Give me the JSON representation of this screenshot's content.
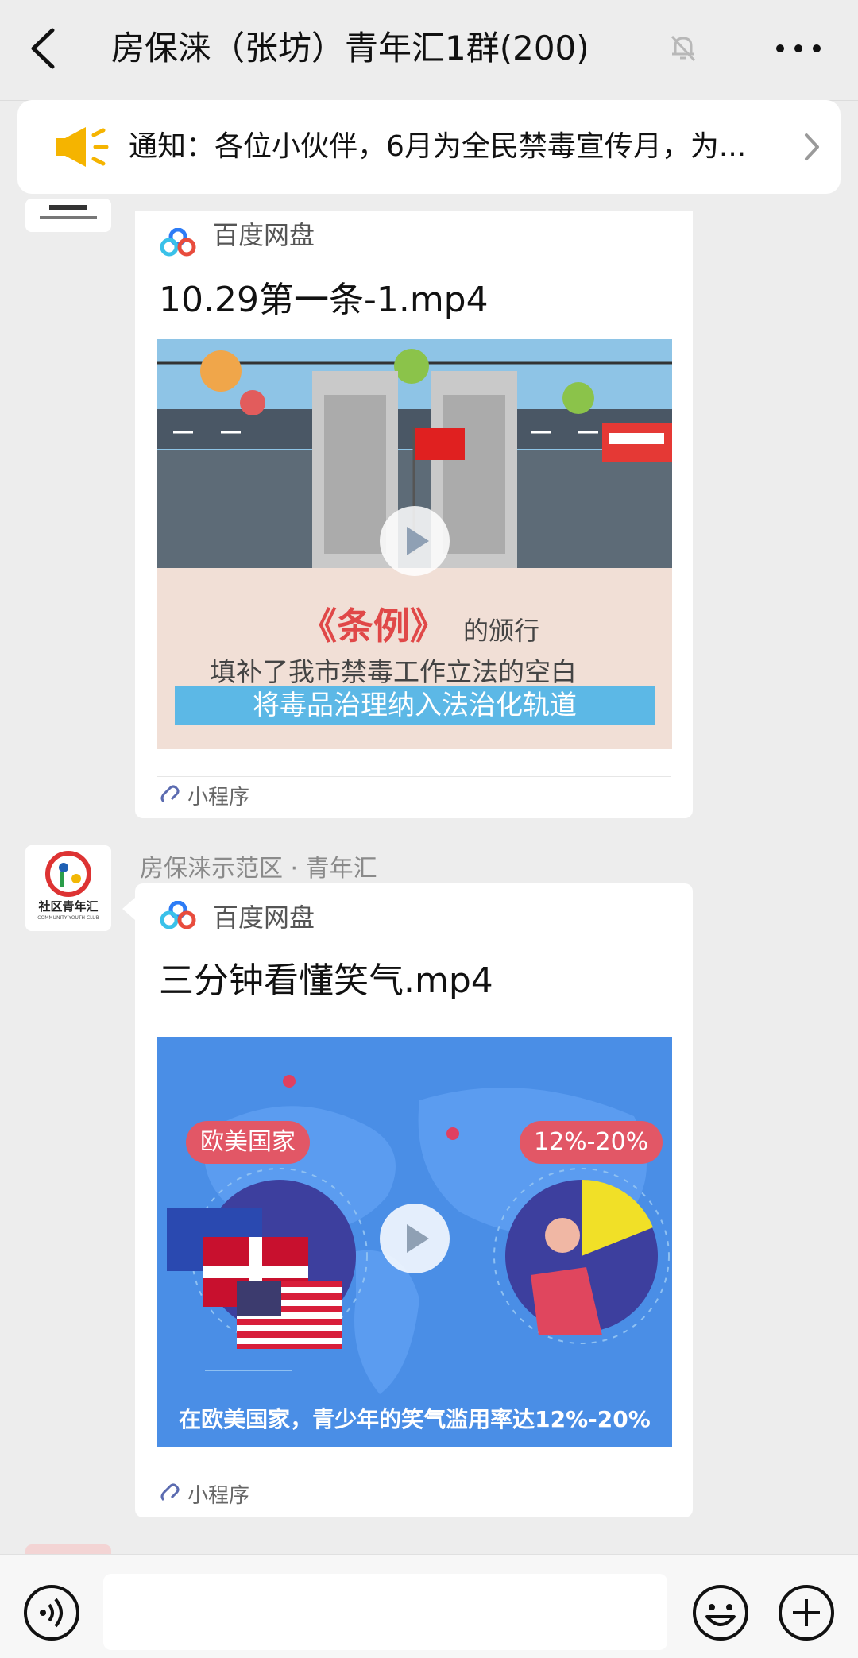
{
  "header": {
    "title": "房保涞（张坊）青年汇1群(200)"
  },
  "notice": {
    "text": "通知：各位小伙伴，6月为全民禁毒宣传月，为..."
  },
  "messages": [
    {
      "sender": "",
      "source_name": "百度网盘",
      "file_title": "10.29第一条-1.mp4",
      "thumb": {
        "line1": "《条例》",
        "line1_suffix": "的颁行",
        "line2": "填补了我市禁毒工作立法的空白",
        "line3": "将毒品治理纳入法治化轨道"
      },
      "mini_label": "小程序"
    },
    {
      "sender": "房保涞示范区 · 青年汇",
      "avatar_label": "社区青年汇",
      "avatar_sub": "COMMUNITY YOUTH CLUB",
      "source_name": "百度网盘",
      "file_title": "三分钟看懂笑气.mp4",
      "thumb": {
        "tag_left": "欧美国家",
        "tag_right": "12%-20%",
        "caption": "在欧美国家，青少年的笑气滥用率达12%-20%"
      },
      "mini_label": "小程序"
    }
  ]
}
